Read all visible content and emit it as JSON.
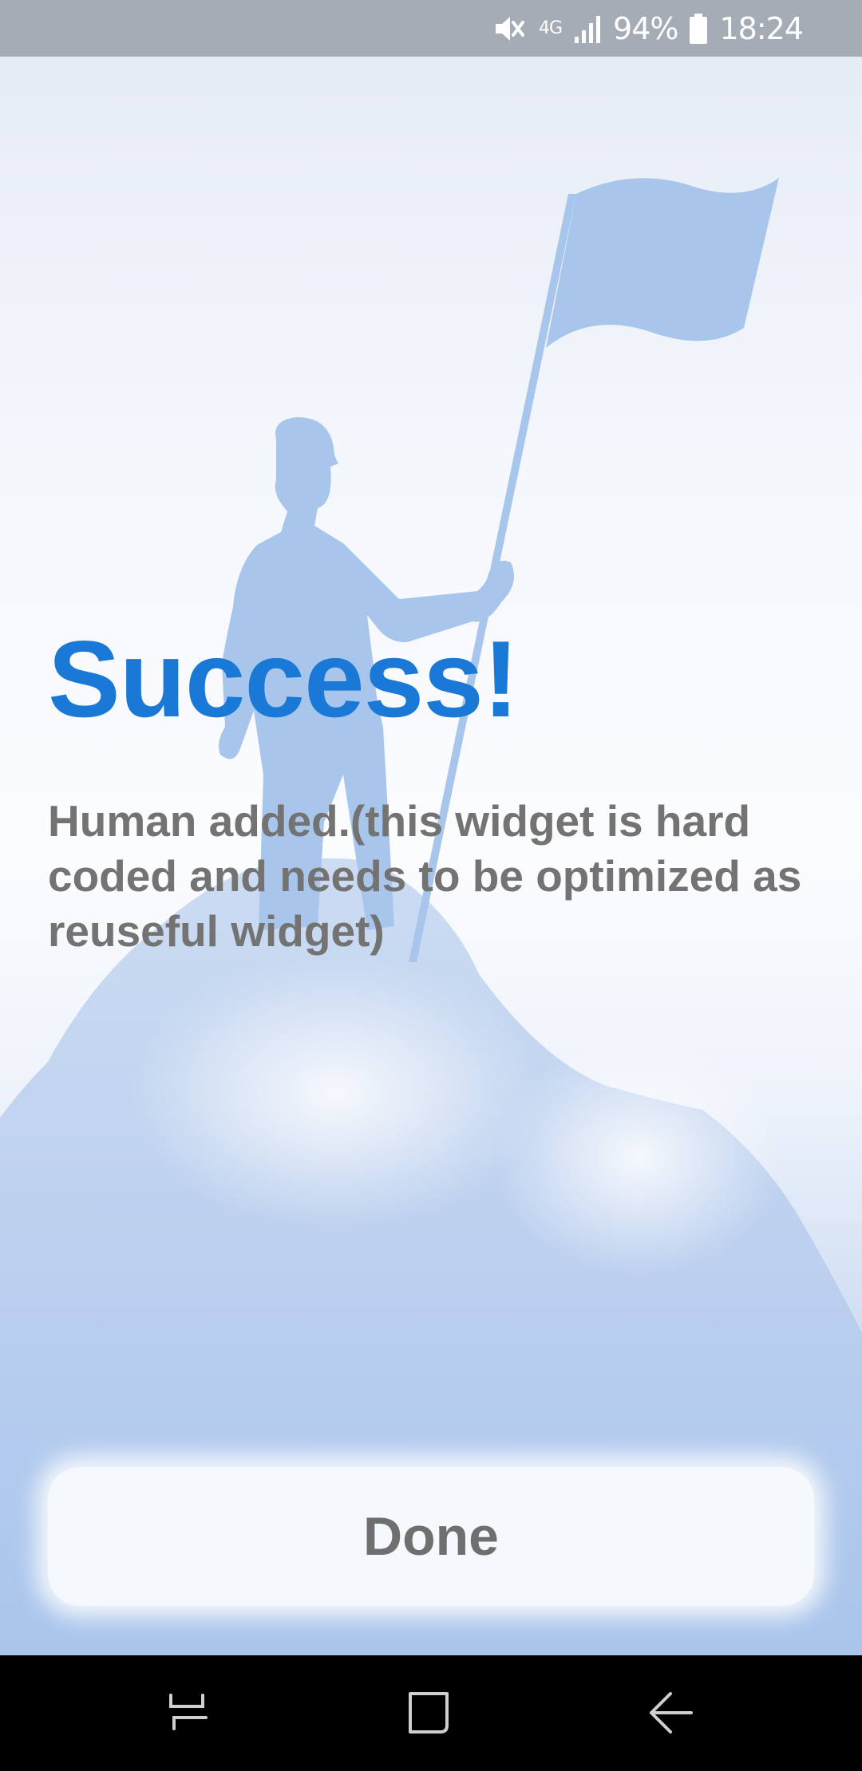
{
  "status_bar": {
    "network": "4G",
    "battery_percent": "94%",
    "time": "18:24",
    "icons": [
      "mute-icon",
      "signal-icon",
      "battery-icon"
    ]
  },
  "content": {
    "title": "Success!",
    "message": "Human added.(this widget is hard coded and needs to be optimized as reuseful widget)"
  },
  "actions": {
    "done_label": "Done"
  },
  "nav_bar": {
    "icons": [
      "recent-apps-icon",
      "home-icon",
      "back-icon"
    ]
  },
  "colors": {
    "title": "#1a78d6",
    "message": "#737373",
    "status_bar": "#a6acb6",
    "illustration": "#a8c6ec"
  }
}
